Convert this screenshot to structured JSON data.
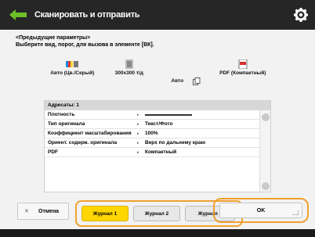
{
  "header": {
    "title": "Сканировать и отправить"
  },
  "instructions": {
    "line1": "<Предыдущие параметры>",
    "line2": "Выберите вид, порог, для вызова в элементе [ВК]."
  },
  "summary": {
    "color_label": "Авто (Цв./Серый)",
    "resolution_label": "300x300 т/д",
    "size_label": "Авто",
    "format_label": "PDF (Компактный)"
  },
  "settings": {
    "header": "Адресаты: 1",
    "rows": [
      {
        "label": "Плотность",
        "value": ""
      },
      {
        "label": "Тип оригинала",
        "value": "Текст/Фото"
      },
      {
        "label": "Коэффициент масштабирования",
        "value": "100%"
      },
      {
        "label": "Ориент. содерж. оригинала",
        "value": "Верх по дальнему краю"
      },
      {
        "label": "PDF",
        "value": "Компактный"
      }
    ]
  },
  "tabs": [
    {
      "label": "Журнал 1"
    },
    {
      "label": "Журнал 2"
    },
    {
      "label": "Журнал 3"
    }
  ],
  "buttons": {
    "cancel": "Отмена",
    "ok": "OK"
  },
  "colors": {
    "accent": "#f0a030",
    "active_tab": "#ffd600",
    "header_bg": "#262626"
  }
}
